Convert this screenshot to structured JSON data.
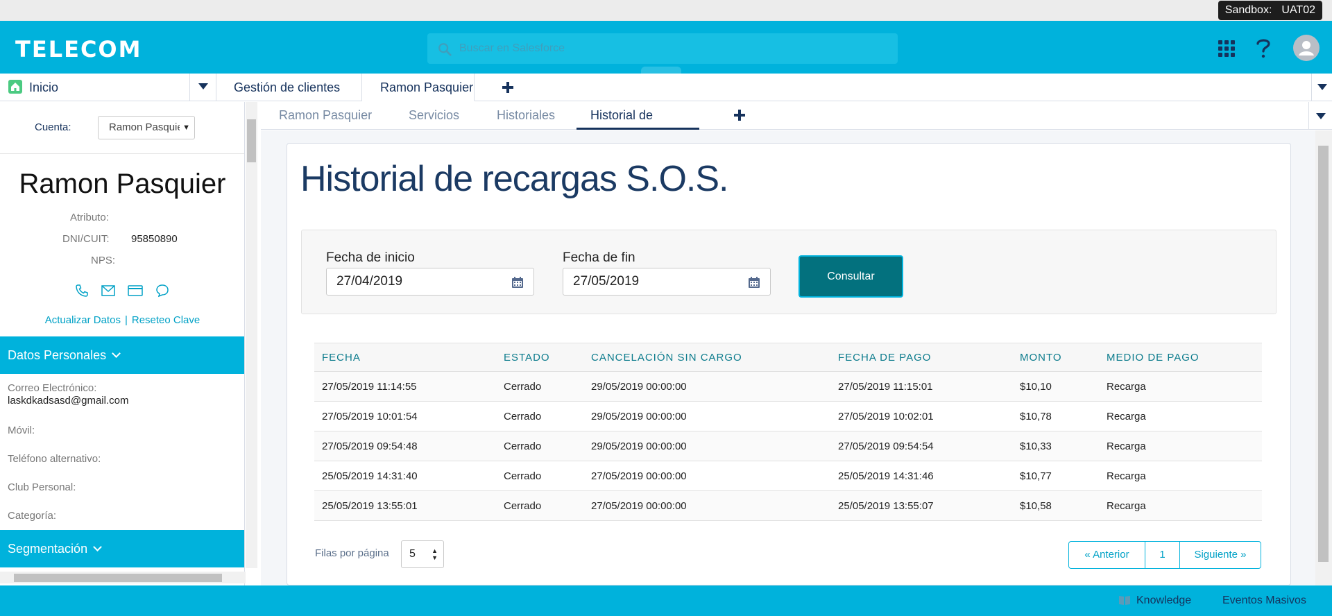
{
  "sandbox": {
    "label": "Sandbox:",
    "env": "UAT02"
  },
  "header": {
    "logo": "TELECOM",
    "search_placeholder": "Buscar en Salesforce"
  },
  "workspace_tabs": {
    "home": "Inicio",
    "tabs": [
      "Gestión de clientes",
      "Ramon Pasquier"
    ]
  },
  "left_panel": {
    "cuenta_label": "Cuenta:",
    "cuenta_value": "Ramon Pasquier",
    "account_name": "Ramon Pasquier",
    "attributes": [
      {
        "label": "Atributo:",
        "value": ""
      },
      {
        "label": "DNI/CUIT:",
        "value": "95850890"
      },
      {
        "label": "NPS:",
        "value": ""
      }
    ],
    "contact_icons": [
      "phone-icon",
      "email-icon",
      "card-icon",
      "chat-icon"
    ],
    "link_update": "Actualizar Datos",
    "link_separator": "|",
    "link_reset": "Reseteo Clave",
    "section_personal": "Datos Personales",
    "fields": [
      {
        "label": "Correo Electrónico:",
        "value": "laskdkadsasd@gmail.com"
      },
      {
        "label": "Móvil:",
        "value": ""
      },
      {
        "label": "Teléfono alternativo:",
        "value": ""
      },
      {
        "label": "Club Personal:",
        "value": ""
      },
      {
        "label": "Categoría:",
        "value": ""
      }
    ],
    "section_segmentacion": "Segmentación"
  },
  "subtabs": [
    "Ramon Pasquier",
    "Servicios",
    "Historiales",
    "Historial de recarg..."
  ],
  "page": {
    "title": "Historial de recargas S.O.S.",
    "fecha_inicio_label": "Fecha de inicio",
    "fecha_inicio_value": "27/04/2019",
    "fecha_fin_label": "Fecha de fin",
    "fecha_fin_value": "27/05/2019",
    "consultar_label": "Consultar"
  },
  "table": {
    "headers": [
      "FECHA",
      "ESTADO",
      "CANCELACIÓN SIN CARGO",
      "FECHA DE PAGO",
      "MONTO",
      "MEDIO DE PAGO"
    ],
    "rows": [
      [
        "27/05/2019 11:14:55",
        "Cerrado",
        "29/05/2019 00:00:00",
        "27/05/2019 11:15:01",
        "$10,10",
        "Recarga"
      ],
      [
        "27/05/2019 10:01:54",
        "Cerrado",
        "29/05/2019 00:00:00",
        "27/05/2019 10:02:01",
        "$10,78",
        "Recarga"
      ],
      [
        "27/05/2019 09:54:48",
        "Cerrado",
        "29/05/2019 00:00:00",
        "27/05/2019 09:54:54",
        "$10,33",
        "Recarga"
      ],
      [
        "25/05/2019 14:31:40",
        "Cerrado",
        "27/05/2019 00:00:00",
        "25/05/2019 14:31:46",
        "$10,77",
        "Recarga"
      ],
      [
        "25/05/2019 13:55:01",
        "Cerrado",
        "27/05/2019 00:00:00",
        "25/05/2019 13:55:07",
        "$10,58",
        "Recarga"
      ]
    ]
  },
  "pagination": {
    "rows_label": "Filas por página",
    "rows_value": "5",
    "prev": "« Anterior",
    "page": "1",
    "next": "Siguiente »"
  },
  "footer": {
    "knowledge": "Knowledge",
    "eventos": "Eventos Masivos"
  }
}
